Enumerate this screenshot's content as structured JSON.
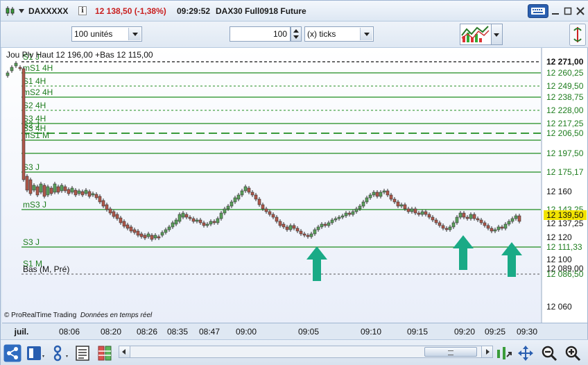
{
  "titlebar": {
    "instrument": "DAXXXXX",
    "price_change": "12 138,50 (-1,38%)",
    "time": "09:29:52",
    "contract": "DAX30 Full0918 Future",
    "price_color": "#c81e1e"
  },
  "toolbar": {
    "units": "100 unités",
    "tick_count": "100",
    "tick_mode": "(x) ticks"
  },
  "chart": {
    "info_text": "Jou Plv Haut 12 196,00 +Bas 12 115,00",
    "copyright_brand": "© ProRealTime Trading",
    "copyright_note": "Données en temps réel",
    "colors": {
      "level_line": "#1e8c1e",
      "up_candle": "#5aa05a",
      "down_candle": "#b0584a",
      "arrow": "#1aaa86",
      "label": "#1e7d1e"
    },
    "levels": [
      {
        "label": "S1 J",
        "price": "12 271,00",
        "dash": "dash"
      },
      {
        "label": "mS1 4H",
        "price": "12 260,25",
        "dash": "solid"
      },
      {
        "label": "S1 4H",
        "price": "12 249,50",
        "dash": "dot"
      },
      {
        "label": "mS2 4H",
        "price": "12 238,75",
        "dash": "solid"
      },
      {
        "label": "S2 4H",
        "price": "12 228,00",
        "dash": "dot"
      },
      {
        "label": "S3 4H",
        "price": "12 217,25",
        "dash": "solid"
      },
      {
        "label": "S2 J",
        "price": "",
        "dash": "none"
      },
      {
        "label": "S3 4H",
        "price": "12 206,50",
        "dash": "longdash"
      },
      {
        "label": "mS1 M",
        "price": "",
        "dash": "solid"
      },
      {
        "label": "",
        "price": "12 197,50",
        "dash": "solid"
      },
      {
        "label": "S3 J",
        "price": "12 175,17",
        "dash": "solid"
      },
      {
        "label": "",
        "price": "12 160",
        "dash": "none"
      },
      {
        "label": "mS3 J",
        "price": "12 143,25",
        "dash": "solid"
      },
      {
        "label": "",
        "price": "12 139,50",
        "dash": "none"
      },
      {
        "label": "",
        "price": "12 137,25",
        "dash": "none"
      },
      {
        "label": "",
        "price": "12 120",
        "dash": "none"
      },
      {
        "label": "S3 J",
        "price": "12 111,33",
        "dash": "solid"
      },
      {
        "label": "",
        "price": "12 100",
        "dash": "none"
      },
      {
        "label": "S1 M",
        "price": "12 089,00",
        "dash": "none"
      },
      {
        "label": "Bas (M, Pré)",
        "price": "12 086,50",
        "dash": "dot"
      },
      {
        "label": "",
        "price": "12 060",
        "dash": "none"
      }
    ],
    "axis_bold_labels": [
      "12 271,00"
    ],
    "current_price_label": "12 139,50",
    "current_price_bg": "#f2e300"
  },
  "time_axis": {
    "labels": [
      "juil.",
      "08:06",
      "08:20",
      "08:26",
      "08:35",
      "08:47",
      "09:00",
      "09:05",
      "09:10",
      "09:15",
      "09:20",
      "09:25",
      "09:30"
    ]
  }
}
